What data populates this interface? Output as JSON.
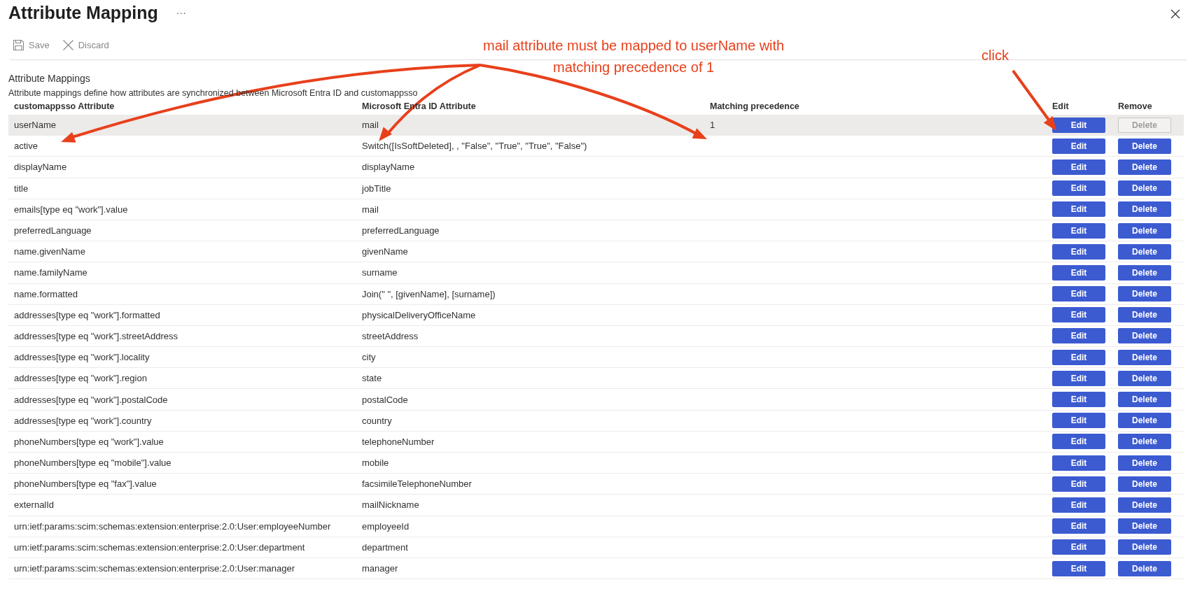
{
  "window": {
    "title": "Attribute Mapping",
    "more": "···"
  },
  "toolbar": [
    {
      "kind": "save",
      "label": "Save",
      "disabled": true
    },
    {
      "kind": "discard",
      "label": "Discard",
      "disabled": true
    }
  ],
  "section": {
    "title": "Attribute Mappings",
    "description": "Attribute mappings define how attributes are synchronized between Microsoft Entra ID and customappsso"
  },
  "table": {
    "columns": [
      "customappsso Attribute",
      "Microsoft Entra ID Attribute",
      "Matching precedence",
      "Edit",
      "Remove"
    ],
    "rows": [
      {
        "target": "userName",
        "source": "mail",
        "precedence": "1",
        "selected": true,
        "edit": "Edit",
        "delete": "Delete",
        "delete_disabled": true
      },
      {
        "target": "active",
        "source": "Switch([IsSoftDeleted], , \"False\", \"True\", \"True\", \"False\")",
        "selected": false,
        "edit": "Edit",
        "delete": "Delete",
        "delete_disabled": false
      },
      {
        "target": "displayName",
        "source": "displayName",
        "selected": false,
        "edit": "Edit",
        "delete": "Delete",
        "delete_disabled": false
      },
      {
        "target": "title",
        "source": "jobTitle",
        "selected": false,
        "edit": "Edit",
        "delete": "Delete",
        "delete_disabled": false
      },
      {
        "target": "emails[type eq \"work\"].value",
        "source": "mail",
        "selected": false,
        "edit": "Edit",
        "delete": "Delete",
        "delete_disabled": false
      },
      {
        "target": "preferredLanguage",
        "source": "preferredLanguage",
        "selected": false,
        "edit": "Edit",
        "delete": "Delete",
        "delete_disabled": false
      },
      {
        "target": "name.givenName",
        "source": "givenName",
        "selected": false,
        "edit": "Edit",
        "delete": "Delete",
        "delete_disabled": false
      },
      {
        "target": "name.familyName",
        "source": "surname",
        "selected": false,
        "edit": "Edit",
        "delete": "Delete",
        "delete_disabled": false
      },
      {
        "target": "name.formatted",
        "source": "Join(\" \", [givenName], [surname])",
        "selected": false,
        "edit": "Edit",
        "delete": "Delete",
        "delete_disabled": false
      },
      {
        "target": "addresses[type eq \"work\"].formatted",
        "source": "physicalDeliveryOfficeName",
        "selected": false,
        "edit": "Edit",
        "delete": "Delete",
        "delete_disabled": false
      },
      {
        "target": "addresses[type eq \"work\"].streetAddress",
        "source": "streetAddress",
        "selected": false,
        "edit": "Edit",
        "delete": "Delete",
        "delete_disabled": false
      },
      {
        "target": "addresses[type eq \"work\"].locality",
        "source": "city",
        "selected": false,
        "edit": "Edit",
        "delete": "Delete",
        "delete_disabled": false
      },
      {
        "target": "addresses[type eq \"work\"].region",
        "source": "state",
        "selected": false,
        "edit": "Edit",
        "delete": "Delete",
        "delete_disabled": false
      },
      {
        "target": "addresses[type eq \"work\"].postalCode",
        "source": "postalCode",
        "selected": false,
        "edit": "Edit",
        "delete": "Delete",
        "delete_disabled": false
      },
      {
        "target": "addresses[type eq \"work\"].country",
        "source": "country",
        "selected": false,
        "edit": "Edit",
        "delete": "Delete",
        "delete_disabled": false
      },
      {
        "target": "phoneNumbers[type eq \"work\"].value",
        "source": "telephoneNumber",
        "selected": false,
        "edit": "Edit",
        "delete": "Delete",
        "delete_disabled": false
      },
      {
        "target": "phoneNumbers[type eq \"mobile\"].value",
        "source": "mobile",
        "selected": false,
        "edit": "Edit",
        "delete": "Delete",
        "delete_disabled": false
      },
      {
        "target": "phoneNumbers[type eq \"fax\"].value",
        "source": "facsimileTelephoneNumber",
        "selected": false,
        "edit": "Edit",
        "delete": "Delete",
        "delete_disabled": false
      },
      {
        "target": "externalId",
        "source": "mailNickname",
        "selected": false,
        "edit": "Edit",
        "delete": "Delete",
        "delete_disabled": false
      },
      {
        "target": "urn:ietf:params:scim:schemas:extension:enterprise:2.0:User:employeeNumber",
        "source": "employeeId",
        "selected": false,
        "edit": "Edit",
        "delete": "Delete",
        "delete_disabled": false
      },
      {
        "target": "urn:ietf:params:scim:schemas:extension:enterprise:2.0:User:department",
        "source": "department",
        "selected": false,
        "edit": "Edit",
        "delete": "Delete",
        "delete_disabled": false
      },
      {
        "target": "urn:ietf:params:scim:schemas:extension:enterprise:2.0:User:manager",
        "source": "manager",
        "selected": false,
        "edit": "Edit",
        "delete": "Delete",
        "delete_disabled": false
      }
    ]
  },
  "annotations": [
    {
      "kind": "note",
      "lines": [
        "mail  attribute must be mapped to userName with",
        "matching precedence of 1"
      ]
    },
    {
      "kind": "click",
      "lines": [
        "click"
      ]
    }
  ]
}
